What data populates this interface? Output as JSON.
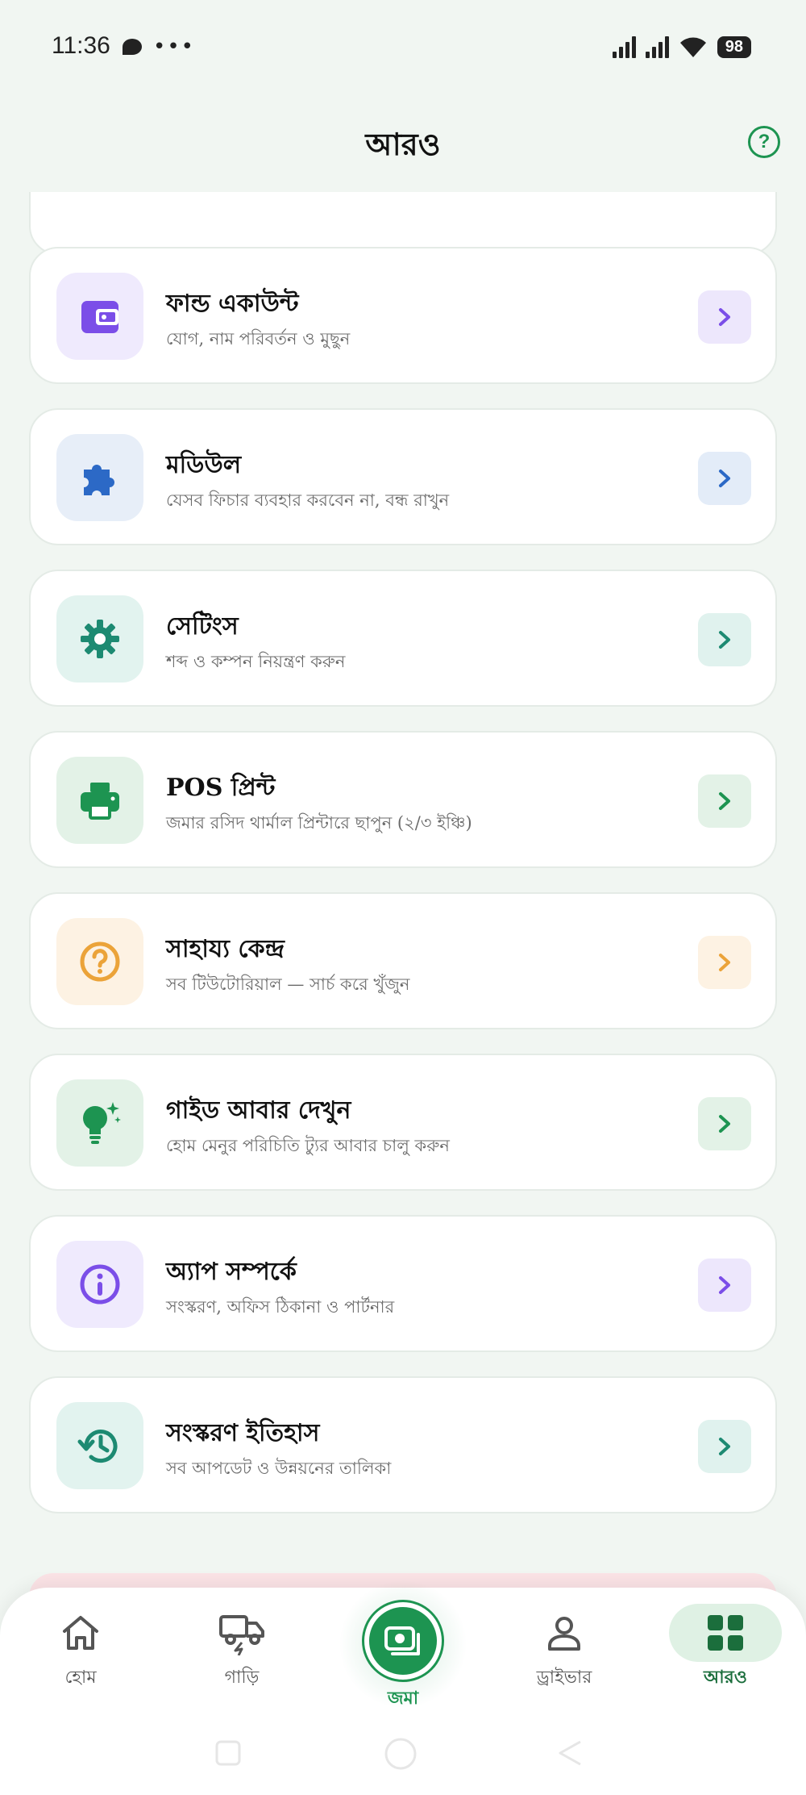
{
  "status_bar": {
    "time": "11:36",
    "battery": "98"
  },
  "header": {
    "title": "আরও"
  },
  "colors": {
    "brand_green": "#1d9451",
    "background": "#f1f6f2"
  },
  "menu": [
    {
      "title": "ফান্ড একাউন্ট",
      "subtitle": "যোগ, নাম পরিবর্তন ও মুছুন",
      "icon": "wallet-icon",
      "tile_bg": "#efeafd",
      "icon_color": "#7b4ee8",
      "arrow_bg": "#ede7fc",
      "arrow_color": "#7b4ee8"
    },
    {
      "title": "মডিউল",
      "subtitle": "যেসব ফিচার ব্যবহার করবেন না, বন্ধ রাখুন",
      "icon": "puzzle-icon",
      "tile_bg": "#e7eef8",
      "icon_color": "#2c69c6",
      "arrow_bg": "#e3ecf8",
      "arrow_color": "#2c69c6"
    },
    {
      "title": "সেটিংস",
      "subtitle": "শব্দ ও কম্পন নিয়ন্ত্রণ করুন",
      "icon": "gear-icon",
      "tile_bg": "#e2f3ef",
      "icon_color": "#1d8a72",
      "arrow_bg": "#e0f2ee",
      "arrow_color": "#1d8a72"
    },
    {
      "title": "POS প্রিন্ট",
      "subtitle": "জমার রসিদ থার্মাল প্রিন্টারে ছাপুন (২/৩ ইঞ্চি)",
      "icon": "printer-icon",
      "tile_bg": "#e3f2e7",
      "icon_color": "#1d9451",
      "arrow_bg": "#e3f2e7",
      "arrow_color": "#1d9451"
    },
    {
      "title": "সাহায্য কেন্দ্র",
      "subtitle": "সব টিউটোরিয়াল — সার্চ করে খুঁজুন",
      "icon": "question-circle-icon",
      "tile_bg": "#fdf2e3",
      "icon_color": "#eba339",
      "arrow_bg": "#fdf2e3",
      "arrow_color": "#eba339"
    },
    {
      "title": "গাইড আবার দেখুন",
      "subtitle": "হোম মেনুর পরিচিতি ট্যুর আবার চালু করুন",
      "icon": "lightbulb-icon",
      "tile_bg": "#e3f2e7",
      "icon_color": "#1d9451",
      "arrow_bg": "#e3f2e7",
      "arrow_color": "#1d9451"
    },
    {
      "title": "অ্যাপ সম্পর্কে",
      "subtitle": "সংস্করণ, অফিস ঠিকানা ও পার্টনার",
      "icon": "info-icon",
      "tile_bg": "#efeafd",
      "icon_color": "#7b4ee8",
      "arrow_bg": "#ede7fc",
      "arrow_color": "#7b4ee8"
    },
    {
      "title": "সংস্করণ ইতিহাস",
      "subtitle": "সব আপডেট ও উন্নয়নের তালিকা",
      "icon": "history-icon",
      "tile_bg": "#e2f3ef",
      "icon_color": "#1d8a72",
      "arrow_bg": "#e0f2ee",
      "arrow_color": "#1d8a72"
    }
  ],
  "bottom_nav": {
    "items": [
      {
        "label": "হোম",
        "icon": "home-icon"
      },
      {
        "label": "গাড়ি",
        "icon": "truck-icon"
      },
      {
        "label": "জমা",
        "icon": "cash-icon"
      },
      {
        "label": "ড্রাইভার",
        "icon": "person-icon"
      },
      {
        "label": "আরও",
        "icon": "grid-icon"
      }
    ],
    "active_index": 4
  }
}
